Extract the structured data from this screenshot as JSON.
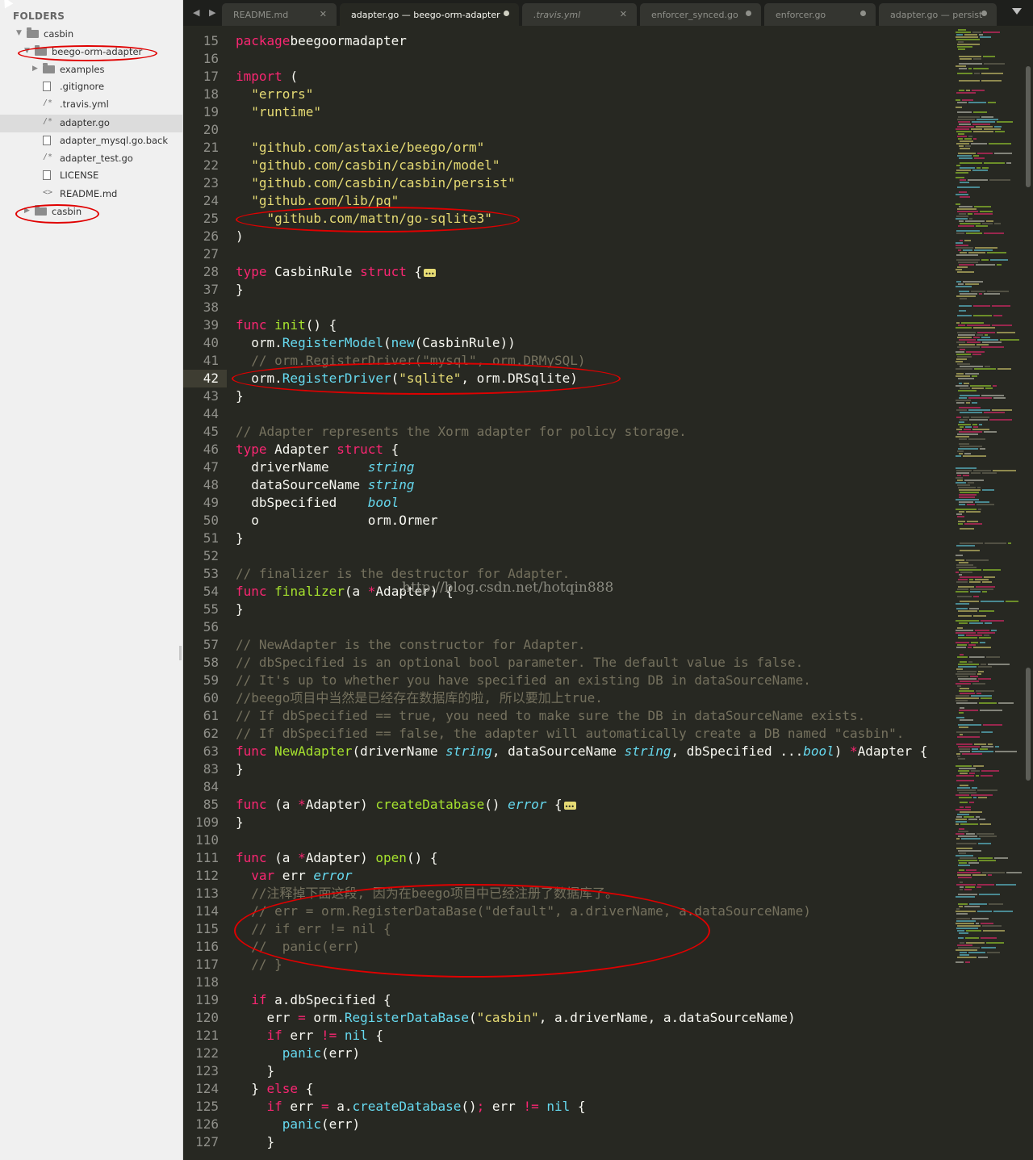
{
  "sidebar": {
    "title": "FOLDERS",
    "items": [
      {
        "label": "casbin",
        "kind": "folder",
        "expanded": true
      },
      {
        "label": "beego-orm-adapter",
        "kind": "folder",
        "expanded": true
      },
      {
        "label": "examples",
        "kind": "folder",
        "expanded": false
      },
      {
        "label": ".gitignore",
        "kind": "file"
      },
      {
        "label": ".travis.yml",
        "kind": "code"
      },
      {
        "label": "adapter.go",
        "kind": "code",
        "selected": true
      },
      {
        "label": "adapter_mysql.go.back",
        "kind": "file"
      },
      {
        "label": "adapter_test.go",
        "kind": "code"
      },
      {
        "label": "LICENSE",
        "kind": "file"
      },
      {
        "label": "README.md",
        "kind": "markup"
      },
      {
        "label": "casbin",
        "kind": "folder",
        "expanded": false
      }
    ]
  },
  "tabs": [
    {
      "label": "README.md",
      "state": "close"
    },
    {
      "label": "adapter.go — beego-orm-adapter",
      "state": "dirty",
      "active": true
    },
    {
      "label": ".travis.yml",
      "state": "close",
      "italic": true
    },
    {
      "label": "enforcer_synced.go",
      "state": "dirty"
    },
    {
      "label": "enforcer.go",
      "state": "dirty"
    },
    {
      "label": "adapter.go — persist",
      "state": "dirty"
    }
  ],
  "editor": {
    "current_line": "42",
    "lines": [
      {
        "n": "15",
        "tokens": [
          [
            "kw",
            "package"
          ],
          [
            "",
            "beegoormadapter"
          ]
        ]
      },
      {
        "n": "16",
        "tokens": []
      },
      {
        "n": "17",
        "tokens": [
          [
            "kw",
            "import"
          ],
          [
            "",
            " ("
          ]
        ]
      },
      {
        "n": "18",
        "tokens": [
          [
            "",
            "  "
          ],
          [
            "st",
            "\"errors\""
          ]
        ]
      },
      {
        "n": "19",
        "tokens": [
          [
            "",
            "  "
          ],
          [
            "st",
            "\"runtime\""
          ]
        ]
      },
      {
        "n": "20",
        "tokens": []
      },
      {
        "n": "21",
        "tokens": [
          [
            "",
            "  "
          ],
          [
            "st",
            "\"github.com/astaxie/beego/orm\""
          ]
        ]
      },
      {
        "n": "22",
        "tokens": [
          [
            "",
            "  "
          ],
          [
            "st",
            "\"github.com/casbin/casbin/model\""
          ]
        ]
      },
      {
        "n": "23",
        "tokens": [
          [
            "",
            "  "
          ],
          [
            "st",
            "\"github.com/casbin/casbin/persist\""
          ]
        ]
      },
      {
        "n": "24",
        "tokens": [
          [
            "",
            "  "
          ],
          [
            "st",
            "\"github.com/lib/pq\""
          ]
        ]
      },
      {
        "n": "25",
        "tokens": [
          [
            "",
            "    "
          ],
          [
            "st",
            "\"github.com/mattn/go-sqlite3\""
          ]
        ]
      },
      {
        "n": "26",
        "tokens": [
          [
            "",
            ")"
          ]
        ]
      },
      {
        "n": "27",
        "tokens": []
      },
      {
        "n": "28",
        "tokens": [
          [
            "kw",
            "type"
          ],
          [
            "",
            " CasbinRule "
          ],
          [
            "kw",
            "struct"
          ],
          [
            "",
            " {"
          ]
        ],
        "fold": true
      },
      {
        "n": "37",
        "tokens": [
          [
            "",
            "}"
          ]
        ]
      },
      {
        "n": "38",
        "tokens": []
      },
      {
        "n": "39",
        "tokens": [
          [
            "kw",
            "func"
          ],
          [
            "",
            " "
          ],
          [
            "fn",
            "init"
          ],
          [
            "",
            "() {"
          ]
        ]
      },
      {
        "n": "40",
        "tokens": [
          [
            "",
            "  orm."
          ],
          [
            "bi",
            "RegisterModel"
          ],
          [
            "",
            "("
          ],
          [
            "bi",
            "new"
          ],
          [
            "",
            "(CasbinRule))"
          ]
        ]
      },
      {
        "n": "41",
        "tokens": [
          [
            "",
            "  "
          ],
          [
            "cm",
            "// orm.RegisterDriver(\"mysql\", orm.DRMySQL)"
          ]
        ]
      },
      {
        "n": "42",
        "tokens": [
          [
            "",
            "  orm."
          ],
          [
            "bi",
            "RegisterDriver"
          ],
          [
            "",
            "("
          ],
          [
            "st",
            "\"sqlite\""
          ],
          [
            "",
            ", orm.DRSqlite)"
          ]
        ]
      },
      {
        "n": "43",
        "tokens": [
          [
            "",
            "}"
          ]
        ]
      },
      {
        "n": "44",
        "tokens": []
      },
      {
        "n": "45",
        "tokens": [
          [
            "cm",
            "// Adapter represents the Xorm adapter for policy storage."
          ]
        ]
      },
      {
        "n": "46",
        "tokens": [
          [
            "kw",
            "type"
          ],
          [
            "",
            " Adapter "
          ],
          [
            "kw",
            "struct"
          ],
          [
            "",
            " {"
          ]
        ]
      },
      {
        "n": "47",
        "tokens": [
          [
            "",
            "  driverName     "
          ],
          [
            "ty",
            "string"
          ]
        ]
      },
      {
        "n": "48",
        "tokens": [
          [
            "",
            "  dataSourceName "
          ],
          [
            "ty",
            "string"
          ]
        ]
      },
      {
        "n": "49",
        "tokens": [
          [
            "",
            "  dbSpecified    "
          ],
          [
            "ty",
            "bool"
          ]
        ]
      },
      {
        "n": "50",
        "tokens": [
          [
            "",
            "  o              orm.Ormer"
          ]
        ]
      },
      {
        "n": "51",
        "tokens": [
          [
            "",
            "}"
          ]
        ]
      },
      {
        "n": "52",
        "tokens": []
      },
      {
        "n": "53",
        "tokens": [
          [
            "cm",
            "// finalizer is the destructor for Adapter."
          ]
        ]
      },
      {
        "n": "54",
        "tokens": [
          [
            "kw",
            "func"
          ],
          [
            "",
            " "
          ],
          [
            "fn",
            "finalizer"
          ],
          [
            "",
            "(a "
          ],
          [
            "kw",
            "*"
          ],
          [
            "",
            "Adapter) {"
          ]
        ]
      },
      {
        "n": "55",
        "tokens": [
          [
            "",
            "}"
          ]
        ]
      },
      {
        "n": "56",
        "tokens": []
      },
      {
        "n": "57",
        "tokens": [
          [
            "cm",
            "// NewAdapter is the constructor for Adapter."
          ]
        ]
      },
      {
        "n": "58",
        "tokens": [
          [
            "cm",
            "// dbSpecified is an optional bool parameter. The default value is false."
          ]
        ]
      },
      {
        "n": "59",
        "tokens": [
          [
            "cm",
            "// It's up to whether you have specified an existing DB in dataSourceName."
          ]
        ]
      },
      {
        "n": "60",
        "tokens": [
          [
            "cm",
            "//beego项目中当然是已经存在数据库的啦, 所以要加上true."
          ]
        ]
      },
      {
        "n": "61",
        "tokens": [
          [
            "cm",
            "// If dbSpecified == true, you need to make sure the DB in dataSourceName exists."
          ]
        ]
      },
      {
        "n": "62",
        "tokens": [
          [
            "cm",
            "// If dbSpecified == false, the adapter will automatically create a DB named \"casbin\"."
          ]
        ]
      },
      {
        "n": "63",
        "tokens": [
          [
            "kw",
            "func"
          ],
          [
            "",
            " "
          ],
          [
            "fn",
            "NewAdapter"
          ],
          [
            "",
            "(driverName "
          ],
          [
            "ty",
            "string"
          ],
          [
            "",
            ", dataSourceName "
          ],
          [
            "ty",
            "string"
          ],
          [
            "",
            ", dbSpecified ..."
          ],
          [
            "ty",
            "bool"
          ],
          [
            "",
            ") "
          ],
          [
            "kw",
            "*"
          ],
          [
            "",
            "Adapter {"
          ]
        ]
      },
      {
        "n": "83",
        "tokens": [
          [
            "",
            "}"
          ]
        ]
      },
      {
        "n": "84",
        "tokens": []
      },
      {
        "n": "85",
        "tokens": [
          [
            "kw",
            "func"
          ],
          [
            "",
            " (a "
          ],
          [
            "kw",
            "*"
          ],
          [
            "",
            "Adapter) "
          ],
          [
            "fn",
            "createDatabase"
          ],
          [
            "",
            "() "
          ],
          [
            "ty",
            "error"
          ],
          [
            "",
            " {"
          ]
        ],
        "fold": true
      },
      {
        "n": "109",
        "tokens": [
          [
            "",
            "}"
          ]
        ]
      },
      {
        "n": "110",
        "tokens": []
      },
      {
        "n": "111",
        "tokens": [
          [
            "kw",
            "func"
          ],
          [
            "",
            " (a "
          ],
          [
            "kw",
            "*"
          ],
          [
            "",
            "Adapter) "
          ],
          [
            "fn",
            "open"
          ],
          [
            "",
            "() {"
          ]
        ]
      },
      {
        "n": "112",
        "tokens": [
          [
            "",
            "  "
          ],
          [
            "kw",
            "var"
          ],
          [
            "",
            " err "
          ],
          [
            "ty",
            "error"
          ]
        ]
      },
      {
        "n": "113",
        "tokens": [
          [
            "",
            "  "
          ],
          [
            "cm",
            "//注释掉下面这段, 因为在beego项目中已经注册了数据库了。"
          ]
        ]
      },
      {
        "n": "114",
        "tokens": [
          [
            "",
            "  "
          ],
          [
            "cm",
            "// err = orm.RegisterDataBase(\"default\", a.driverName, a.dataSourceName)"
          ]
        ]
      },
      {
        "n": "115",
        "tokens": [
          [
            "",
            "  "
          ],
          [
            "cm",
            "// if err != nil {"
          ]
        ]
      },
      {
        "n": "116",
        "tokens": [
          [
            "",
            "  "
          ],
          [
            "cm",
            "//  panic(err)"
          ]
        ]
      },
      {
        "n": "117",
        "tokens": [
          [
            "",
            "  "
          ],
          [
            "cm",
            "// }"
          ]
        ]
      },
      {
        "n": "118",
        "tokens": []
      },
      {
        "n": "119",
        "tokens": [
          [
            "",
            "  "
          ],
          [
            "kw",
            "if"
          ],
          [
            "",
            " a.dbSpecified {"
          ]
        ]
      },
      {
        "n": "120",
        "tokens": [
          [
            "",
            "    err "
          ],
          [
            "kw",
            "="
          ],
          [
            "",
            " orm."
          ],
          [
            "bi",
            "RegisterDataBase"
          ],
          [
            "",
            "("
          ],
          [
            "st",
            "\"casbin\""
          ],
          [
            "",
            ", a.driverName, a.dataSourceName)"
          ]
        ]
      },
      {
        "n": "121",
        "tokens": [
          [
            "",
            "    "
          ],
          [
            "kw",
            "if"
          ],
          [
            "",
            " err "
          ],
          [
            "kw",
            "!="
          ],
          [
            "",
            " "
          ],
          [
            "bi",
            "nil"
          ],
          [
            "",
            " {"
          ]
        ]
      },
      {
        "n": "122",
        "tokens": [
          [
            "",
            "      "
          ],
          [
            "bi",
            "panic"
          ],
          [
            "",
            "(err)"
          ]
        ]
      },
      {
        "n": "123",
        "tokens": [
          [
            "",
            "    }"
          ]
        ]
      },
      {
        "n": "124",
        "tokens": [
          [
            "",
            "  } "
          ],
          [
            "kw",
            "else"
          ],
          [
            "",
            " {"
          ]
        ]
      },
      {
        "n": "125",
        "tokens": [
          [
            "",
            "    "
          ],
          [
            "kw",
            "if"
          ],
          [
            "",
            " err "
          ],
          [
            "kw",
            "="
          ],
          [
            "",
            " a."
          ],
          [
            "bi",
            "createDatabase"
          ],
          [
            "",
            "()"
          ],
          [
            "kw",
            ";"
          ],
          [
            "",
            " err "
          ],
          [
            "kw",
            "!="
          ],
          [
            "",
            " "
          ],
          [
            "bi",
            "nil"
          ],
          [
            "",
            " {"
          ]
        ]
      },
      {
        "n": "126",
        "tokens": [
          [
            "",
            "      "
          ],
          [
            "bi",
            "panic"
          ],
          [
            "",
            "(err)"
          ]
        ]
      },
      {
        "n": "127",
        "tokens": [
          [
            "",
            "    }"
          ]
        ]
      }
    ]
  },
  "watermark": "http://blog.csdn.net/hotqin888",
  "colors": {
    "bg": "#272822",
    "keyword": "#f92672",
    "string": "#e6db74",
    "function": "#a6e22e",
    "builtin": "#66d9ef",
    "comment": "#75715e",
    "annotation": "#e00000"
  },
  "icons": {
    "folder": "folder-icon",
    "file": "file-icon",
    "code": "code-file-icon",
    "markup": "markup-file-icon"
  }
}
